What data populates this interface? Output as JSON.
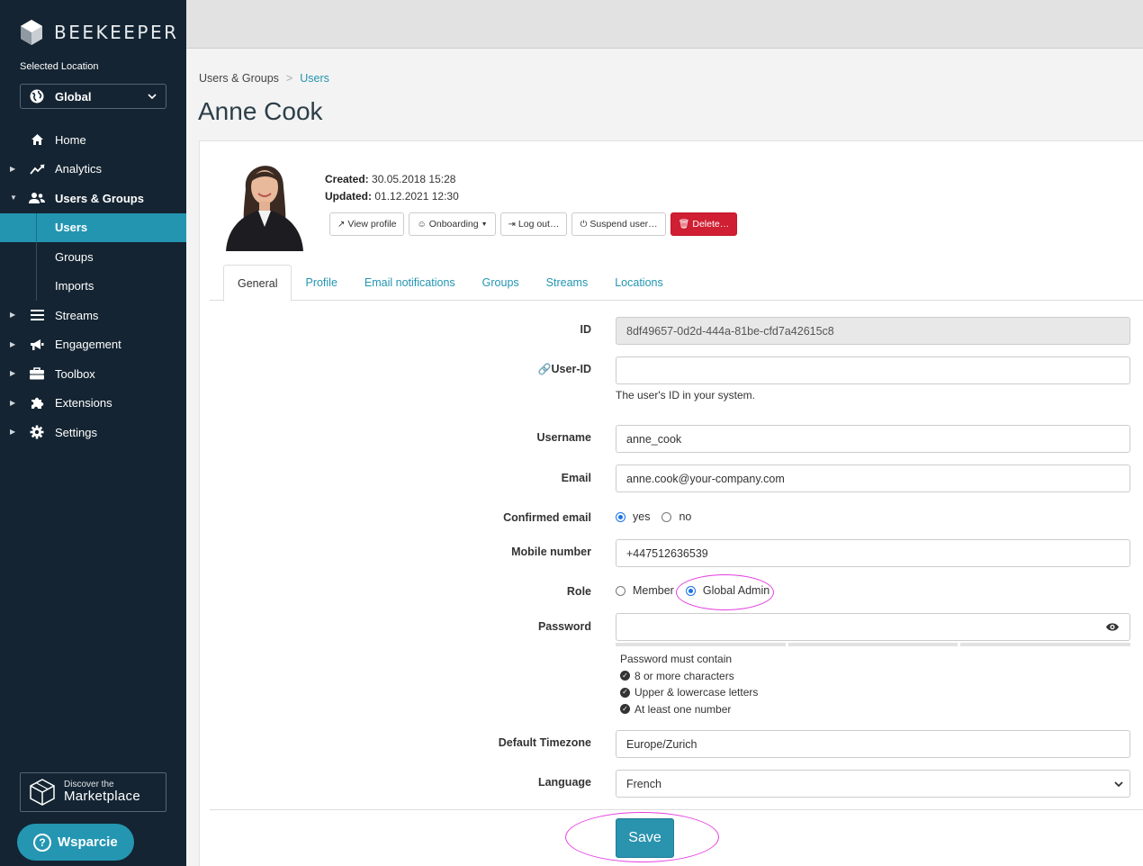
{
  "brand": {
    "name": "BEEKEEPER"
  },
  "location": {
    "label": "Selected Location",
    "value": "Global"
  },
  "nav": [
    {
      "label": "Home",
      "icon": "home-icon",
      "caret": false
    },
    {
      "label": "Analytics",
      "icon": "analytics-icon",
      "caret": true
    },
    {
      "label": "Users & Groups",
      "icon": "users-icon",
      "caret": true,
      "expanded": true
    },
    {
      "label": "Users",
      "sub": true,
      "active": true
    },
    {
      "label": "Groups",
      "sub": true
    },
    {
      "label": "Imports",
      "sub": true
    },
    {
      "label": "Streams",
      "icon": "streams-icon",
      "caret": true
    },
    {
      "label": "Engagement",
      "icon": "megaphone-icon",
      "caret": true
    },
    {
      "label": "Toolbox",
      "icon": "toolbox-icon",
      "caret": true
    },
    {
      "label": "Extensions",
      "icon": "puzzle-icon",
      "caret": true
    },
    {
      "label": "Settings",
      "icon": "gear-icon",
      "caret": true
    }
  ],
  "marketplace": {
    "small": "Discover the",
    "big": "Marketplace"
  },
  "support": {
    "label": "Wsparcie"
  },
  "breadcrumb": {
    "parent": "Users & Groups",
    "sep": ">",
    "current": "Users"
  },
  "page_title": "Anne Cook",
  "user_meta": {
    "created_label": "Created:",
    "created_value": "30.05.2018 15:28",
    "updated_label": "Updated:",
    "updated_value": "01.12.2021 12:30"
  },
  "actions": {
    "view_profile": "View profile",
    "onboarding": "Onboarding",
    "log_out": "Log out…",
    "suspend": "Suspend user…",
    "delete": "Delete…"
  },
  "tabs": [
    "General",
    "Profile",
    "Email notifications",
    "Groups",
    "Streams",
    "Locations"
  ],
  "form": {
    "id_label": "ID",
    "id_value": "8df49657-0d2d-444a-81be-cfd7a42615c8",
    "userid_label": "User-ID",
    "userid_value": "",
    "userid_help": "The user's ID in your system.",
    "username_label": "Username",
    "username_value": "anne_cook",
    "email_label": "Email",
    "email_value": "anne.cook@your-company.com",
    "confirmed_label": "Confirmed email",
    "confirmed_yes": "yes",
    "confirmed_no": "no",
    "confirmed_selected": "yes",
    "mobile_label": "Mobile number",
    "mobile_value": "+447512636539",
    "role_label": "Role",
    "role_member": "Member",
    "role_admin": "Global Admin",
    "role_selected": "Global Admin",
    "password_label": "Password",
    "password_value": "",
    "pw_title": "Password must contain",
    "pw_rules": [
      "8 or more characters",
      "Upper & lowercase letters",
      "At least one number"
    ],
    "timezone_label": "Default Timezone",
    "timezone_value": "Europe/Zurich",
    "language_label": "Language",
    "language_value": "French",
    "save_label": "Save"
  },
  "colors": {
    "sidebar": "#142432",
    "accent": "#2395b1",
    "danger": "#d01f32",
    "highlight": "#e53de0"
  }
}
